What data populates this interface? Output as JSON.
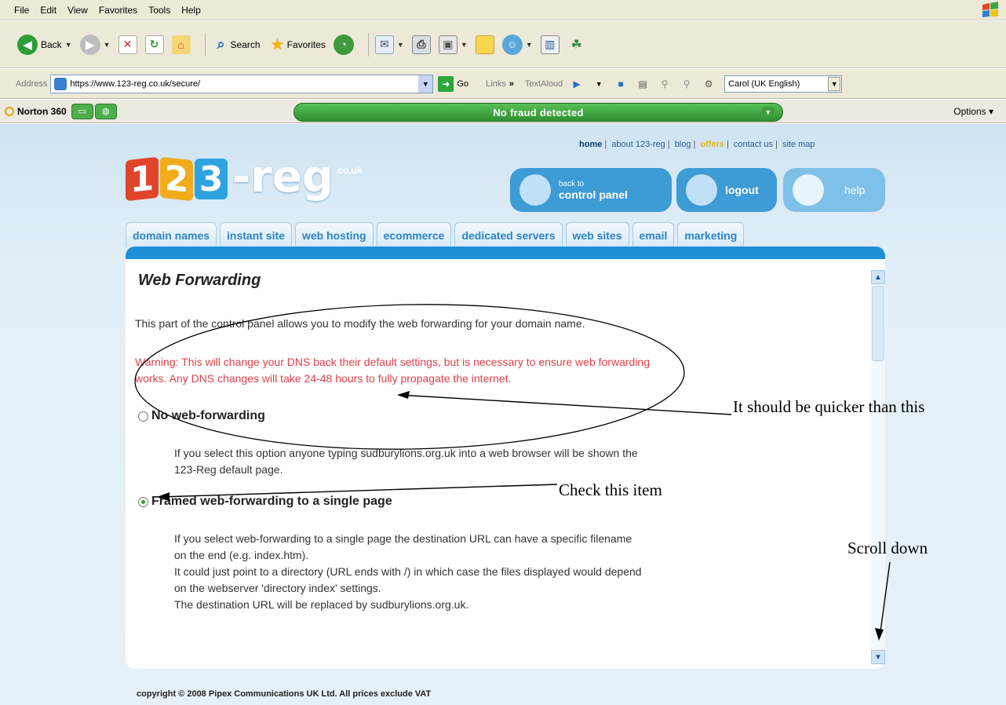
{
  "menubar": {
    "items": [
      "File",
      "Edit",
      "View",
      "Favorites",
      "Tools",
      "Help"
    ]
  },
  "toolbar": {
    "back_label": "Back",
    "search_label": "Search",
    "favorites_label": "Favorites"
  },
  "address": {
    "label": "Address",
    "url": "https://www.123-reg.co.uk/secure/",
    "go_label": "Go",
    "links_label": "Links",
    "textaloud_label": "TextAloud",
    "voice": "Carol (UK English)"
  },
  "norton": {
    "brand": "Norton 360",
    "status": "No fraud detected",
    "options_label": "Options"
  },
  "site": {
    "toplinks": {
      "home": "home",
      "about": "about 123-reg",
      "blog": "blog",
      "offers": "offers",
      "contact": "contact us",
      "sitemap": "site map"
    },
    "logo": {
      "d1": "1",
      "d2": "2",
      "d3": "3",
      "reg": "-reg",
      "tld": ".co.uk"
    },
    "control_panel": {
      "line1": "back to",
      "line2": "control panel"
    },
    "logout_label": "logout",
    "help_label": "help",
    "tabs": [
      "domain names",
      "instant site",
      "web hosting",
      "ecommerce",
      "dedicated servers",
      "web sites",
      "email",
      "marketing"
    ],
    "copyright": "copyright © 2008 Pipex Communications UK Ltd. All prices exclude VAT"
  },
  "content": {
    "title": "Web Forwarding",
    "intro": "This part of the control panel allows you to modify the web forwarding for your domain name.",
    "warning_line1": "Warning: This will change your DNS back their default settings, but is necessary to ensure web forwarding",
    "warning_line2": "works. Any DNS changes will take 24-48 hours to fully propagate the internet.",
    "option1": {
      "label": "No web-forwarding",
      "selected": false,
      "desc_line1": "If you select this option anyone typing sudburylions.org.uk into a web browser will be shown the",
      "desc_line2": "123-Reg default page."
    },
    "option2": {
      "label": "Framed web-forwarding to a single page",
      "selected": true,
      "desc_line1": "If you select web-forwarding to a single page the destination URL can have a specific filename",
      "desc_line2": "on the end (e.g. index.htm).",
      "desc_line3": "It could just point to a directory (URL ends with /) in which case the files displayed would depend",
      "desc_line4": "on the webserver 'directory index' settings.",
      "desc_line5": "The destination URL will be replaced by sudburylions.org.uk."
    }
  },
  "annotations": {
    "quicker": "It should be quicker than this",
    "check": "Check this item",
    "scroll": "Scroll down"
  },
  "colors": {
    "accent_blue": "#1f8fd9",
    "tab_text": "#2a84c7",
    "warning_red": "#e0414b",
    "norton_green": "#2f8f2f"
  }
}
